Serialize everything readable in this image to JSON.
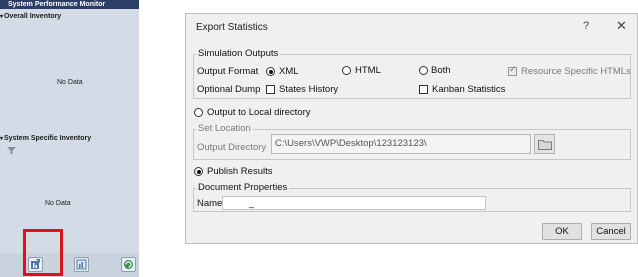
{
  "monitor": {
    "title": "System Performance Monitor",
    "overall_label": "Overall Inventory",
    "overall_status": "No Data",
    "specific_label": "System Specific Inventory",
    "specific_status": "No Data",
    "toolbar_icons": [
      "export-statistics-icon",
      "chart-report-icon",
      "refresh-icon"
    ],
    "highlight_color": "#e0101a"
  },
  "dialog": {
    "title": "Export Statistics",
    "help": "?",
    "close": "✕",
    "sim_outputs": {
      "group_label": "Simulation Outputs",
      "format_label": "Output Format",
      "formats": [
        "XML",
        "HTML",
        "Both"
      ],
      "selected_format": "XML",
      "resource_specific": "Resource Specific HTMLs",
      "optional_dump_label": "Optional Dump",
      "states_history": "States History",
      "kanban_statistics": "Kanban Statistics"
    },
    "output_local_dir": "Output to Local directory",
    "set_location": {
      "group_label": "Set Location",
      "dir_label": "Output Directory",
      "dir_value": "C:\\Users\\VWP\\Desktop\\123123123\\"
    },
    "publish_results": "Publish Results",
    "doc_props": {
      "group_label": "Document Properties",
      "name_label": "Name",
      "name_value": "_"
    },
    "ok_label": "OK",
    "cancel_label": "Cancel"
  }
}
